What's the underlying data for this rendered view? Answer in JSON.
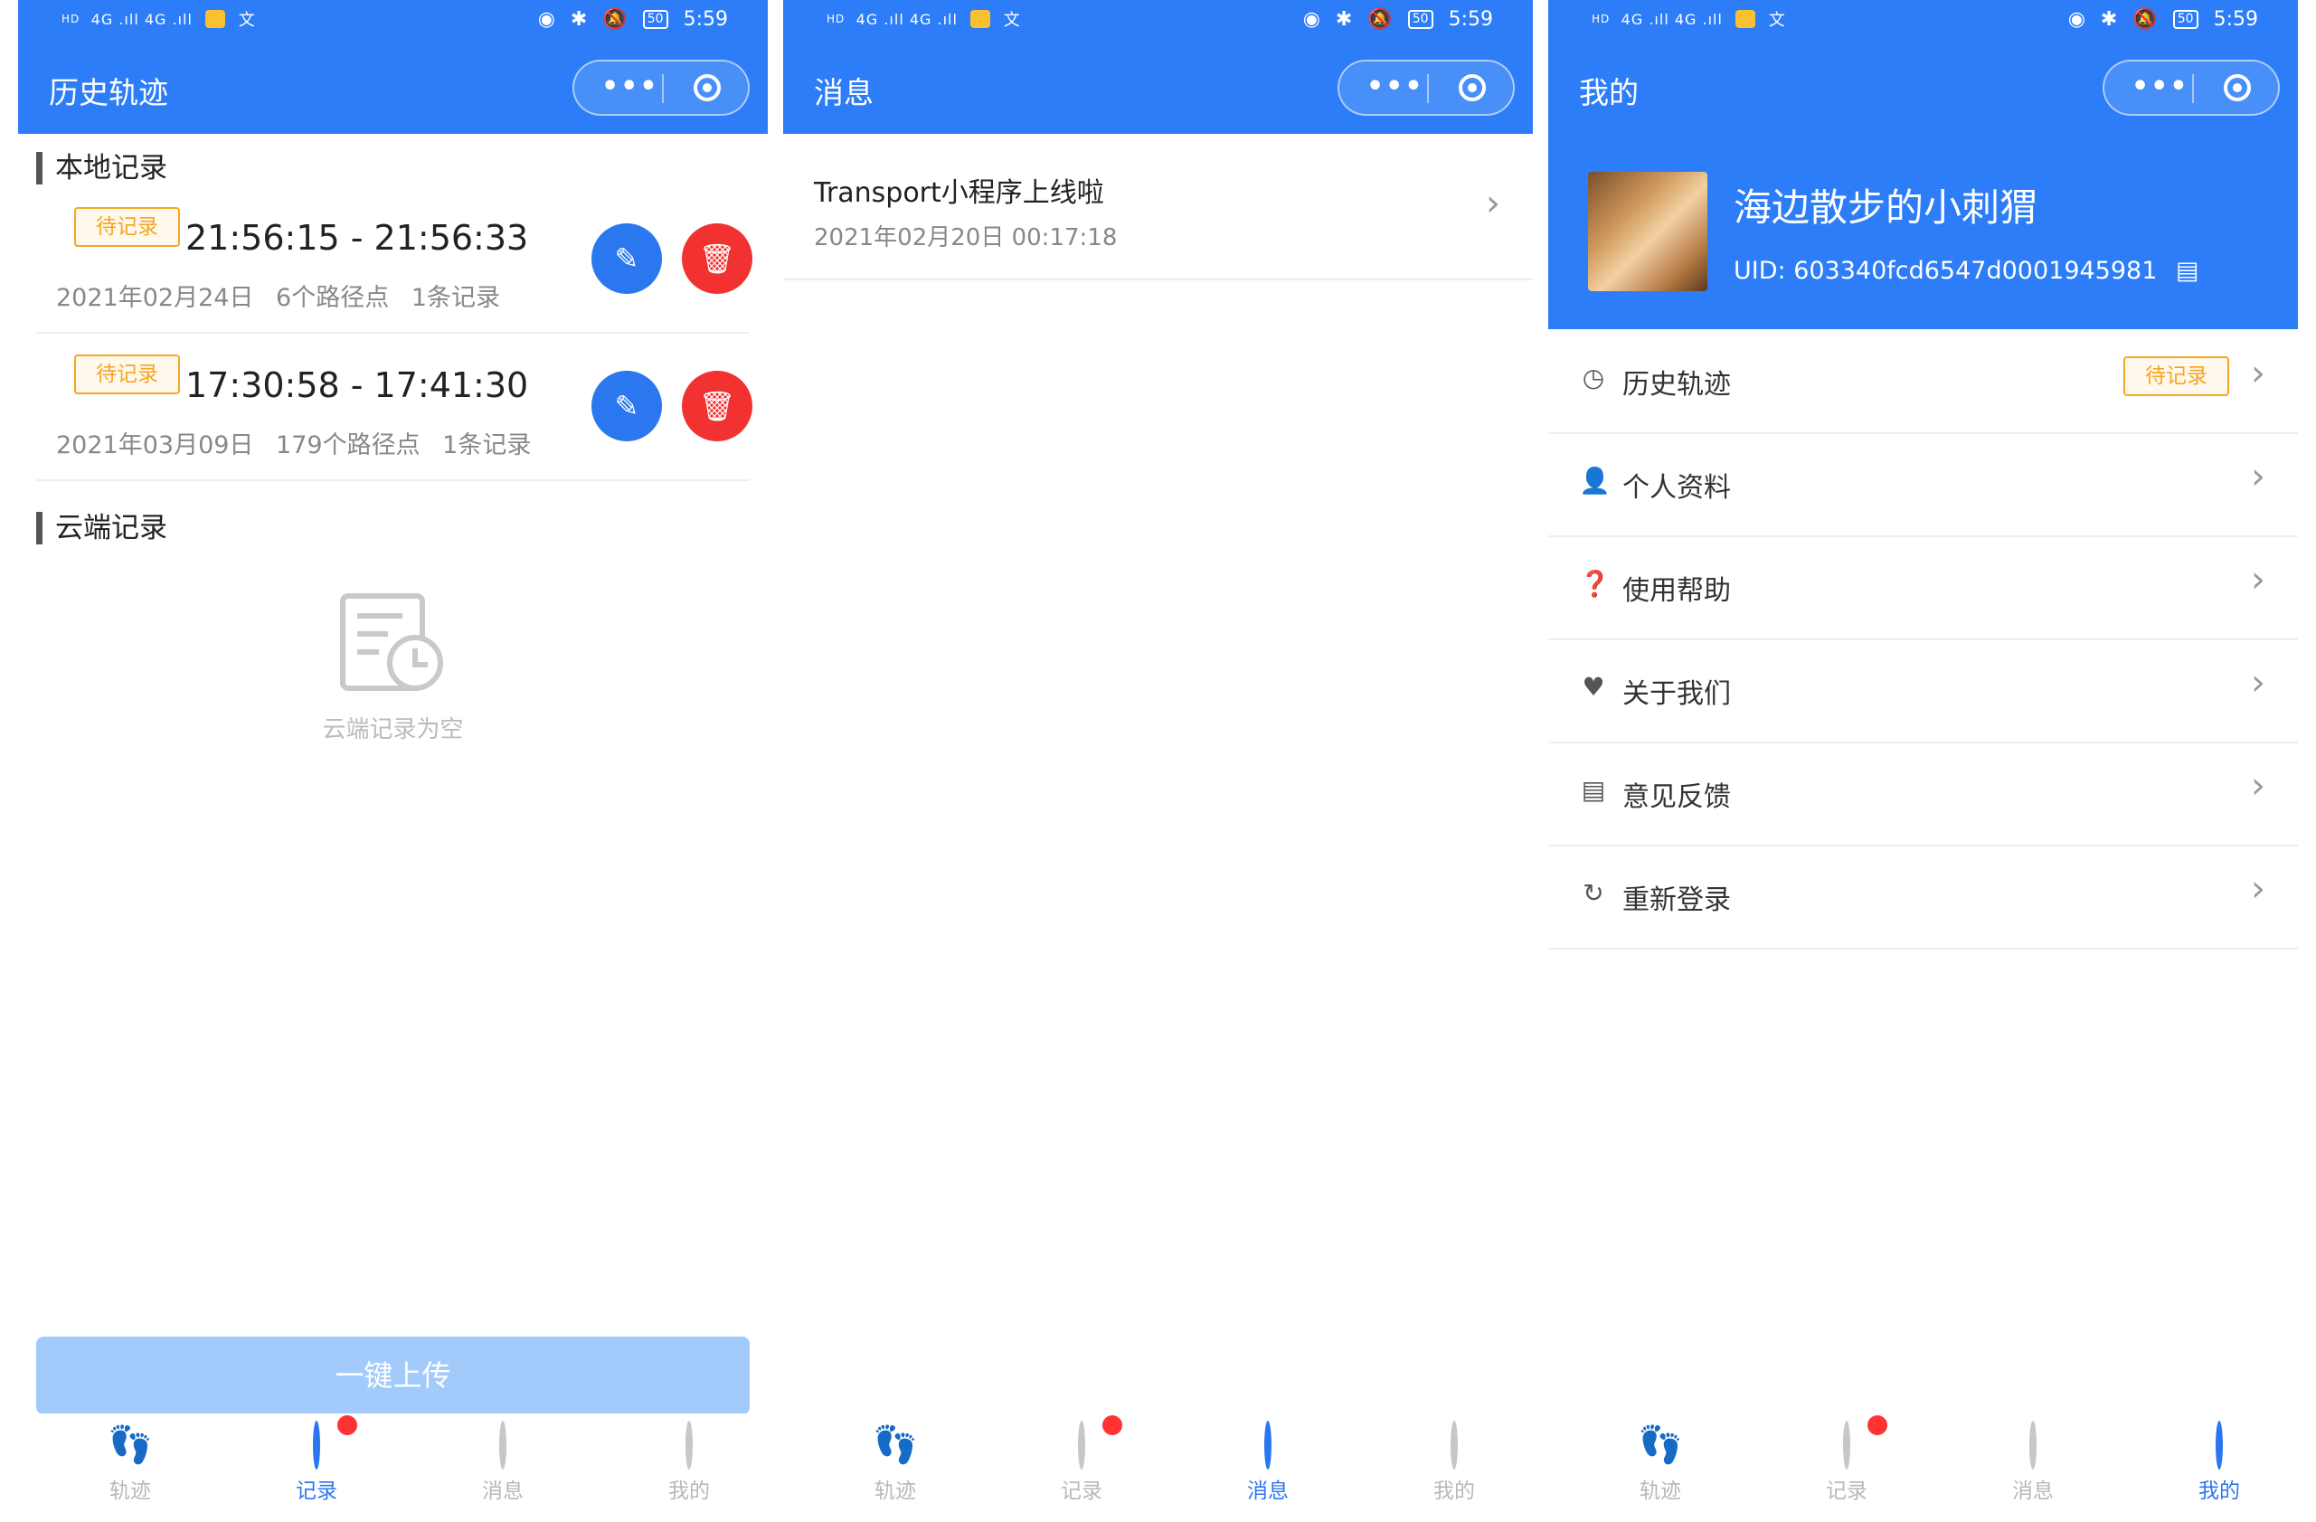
{
  "status_bar": {
    "hd": "HD",
    "signal": "4G .ıll 4G .ıll",
    "ime": "文",
    "battery": "50",
    "time": "5:59"
  },
  "capsule": {
    "more": "•••"
  },
  "history": {
    "nav_title": "历史轨迹",
    "local_section": "本地记录",
    "records": [
      {
        "badge": "待记录",
        "time": "21:56:15 - 21:56:33",
        "date": "2021年02月24日",
        "points": "6个路径点",
        "count": "1条记录"
      },
      {
        "badge": "待记录",
        "time": "17:30:58 - 17:41:30",
        "date": "2021年03月09日",
        "points": "179个路径点",
        "count": "1条记录"
      }
    ],
    "cloud_section": "云端记录",
    "cloud_empty": "云端记录为空",
    "upload_button": "一键上传"
  },
  "messages": {
    "nav_title": "消息",
    "items": [
      {
        "title": "Transport小程序上线啦",
        "time": "2021年02月20日 00:17:18"
      }
    ]
  },
  "mine": {
    "nav_title": "我的",
    "nickname": "海边散步的小刺猬",
    "uid": "UID: 603340fcd6547d0001945981",
    "menu": [
      {
        "label": "历史轨迹",
        "icon": "clock-icon",
        "badge": "待记录"
      },
      {
        "label": "个人资料",
        "icon": "person-icon"
      },
      {
        "label": "使用帮助",
        "icon": "help-icon"
      },
      {
        "label": "关于我们",
        "icon": "heart-icon"
      },
      {
        "label": "意见反馈",
        "icon": "document-icon"
      },
      {
        "label": "重新登录",
        "icon": "refresh-icon"
      }
    ]
  },
  "tabbar": {
    "tabs": [
      {
        "label": "轨迹",
        "icon": "footprint-icon"
      },
      {
        "label": "记录",
        "icon": "clock-icon"
      },
      {
        "label": "消息",
        "icon": "message-icon"
      },
      {
        "label": "我的",
        "icon": "user-icon"
      }
    ]
  },
  "colors": {
    "primary": "#2c7df7",
    "danger": "#f23131",
    "badge": "#f5a623",
    "upload_disabled": "#a2cbfc"
  }
}
